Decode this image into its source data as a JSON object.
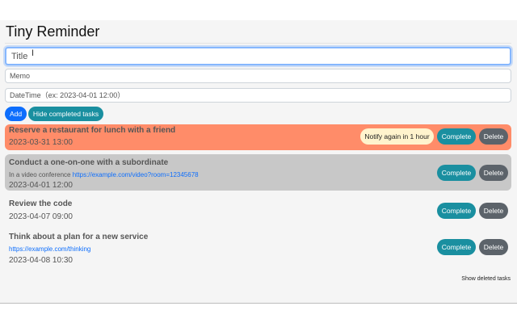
{
  "app": {
    "title": "Tiny Reminder"
  },
  "form": {
    "title_placeholder": "Title",
    "memo_placeholder": "Memo",
    "datetime_placeholder": "DateTime（ex: 2023-04-01 12:00）",
    "add_label": "Add",
    "hide_completed_label": "Hide completed tasks"
  },
  "tasks": [
    {
      "name": "Reserve a restaurant for lunch with a friend",
      "datetime": "2023-03-31 13:00",
      "notify_label": "Notify again in 1 hour",
      "complete_label": "Complete",
      "delete_label": "Delete",
      "status_color": "#ff8c69"
    },
    {
      "name": "Conduct a one-on-one with a subordinate",
      "memo_text": "In a video conference ",
      "memo_link": "https://example.com/video?room=12345678",
      "datetime": "2023-04-01 12:00",
      "complete_label": "Complete",
      "delete_label": "Delete",
      "status_color": "#c8c8c8"
    },
    {
      "name": "Review the code",
      "datetime": "2023-04-07 09:00",
      "complete_label": "Complete",
      "delete_label": "Delete"
    },
    {
      "name": "Think about a plan for a new service",
      "memo_link": "https://example.com/thinking",
      "datetime": "2023-04-08 10:30",
      "complete_label": "Complete",
      "delete_label": "Delete"
    }
  ],
  "footer": {
    "show_deleted_label": "Show deleted tasks"
  },
  "colors": {
    "primary": "#0d6efd",
    "info": "#1a8fa0",
    "secondary": "#5c636a"
  }
}
